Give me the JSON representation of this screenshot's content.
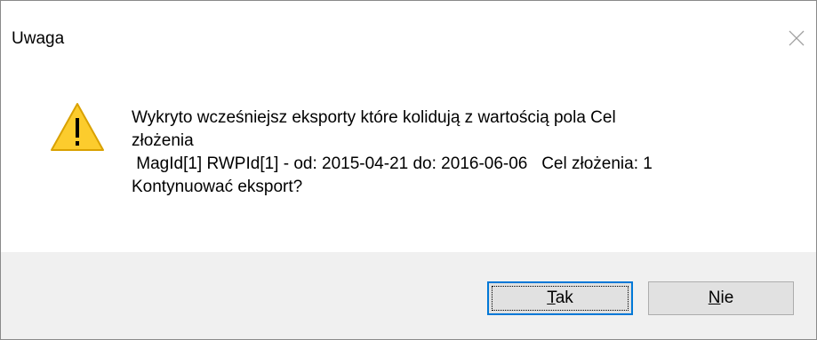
{
  "dialog": {
    "title": "Uwaga",
    "message_lines": [
      "Wykryto wcześniejsz eksporty które kolidują z wartością pola Cel",
      "złożenia",
      " MagId[1] RWPId[1] - od: 2015-04-21 do: 2016-06-06   Cel złożenia: 1",
      "Kontynuować eksport?"
    ],
    "icon": "warning-icon",
    "close_icon": "close-icon"
  },
  "buttons": {
    "yes": {
      "mnemonic": "T",
      "rest": "ak"
    },
    "no": {
      "mnemonic": "N",
      "rest": "ie"
    }
  },
  "colors": {
    "warning_fill": "#fccc2d",
    "warning_border": "#d9a100",
    "footer_bg": "#f0f0f0",
    "default_button_border": "#0078d7"
  }
}
